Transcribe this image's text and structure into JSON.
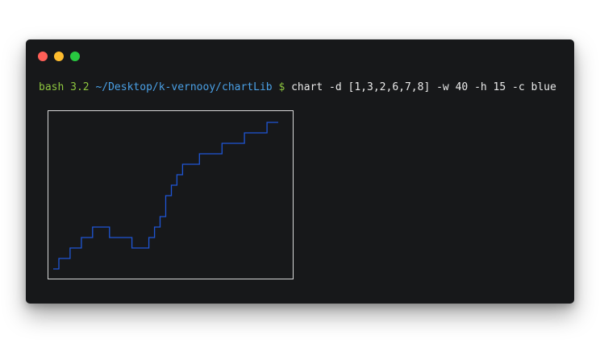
{
  "window": {
    "traffic_lights": [
      {
        "name": "close",
        "color": "#ff5f57"
      },
      {
        "name": "minimize",
        "color": "#febc2e"
      },
      {
        "name": "maximize",
        "color": "#28c840"
      }
    ],
    "background": "#17181a"
  },
  "prompt": {
    "shell": "bash 3.2",
    "path": "~/Desktop/k-vernooy/chartLib",
    "symbol": "$",
    "command": "chart -d [1,3,2,6,7,8] -w 40 -h 15 -c blue"
  },
  "colors": {
    "shell": "#8ec63f",
    "path": "#4aa0e6",
    "command": "#eaeaea",
    "chart_line": "#1f56d6",
    "chart_border": "#d8d8d8"
  },
  "chart_data": {
    "type": "line",
    "title": "",
    "xlabel": "",
    "ylabel": "",
    "data": [
      1,
      3,
      2,
      6,
      7,
      8
    ],
    "width_chars": 40,
    "height_chars": 15,
    "color": "blue",
    "grid": false
  }
}
